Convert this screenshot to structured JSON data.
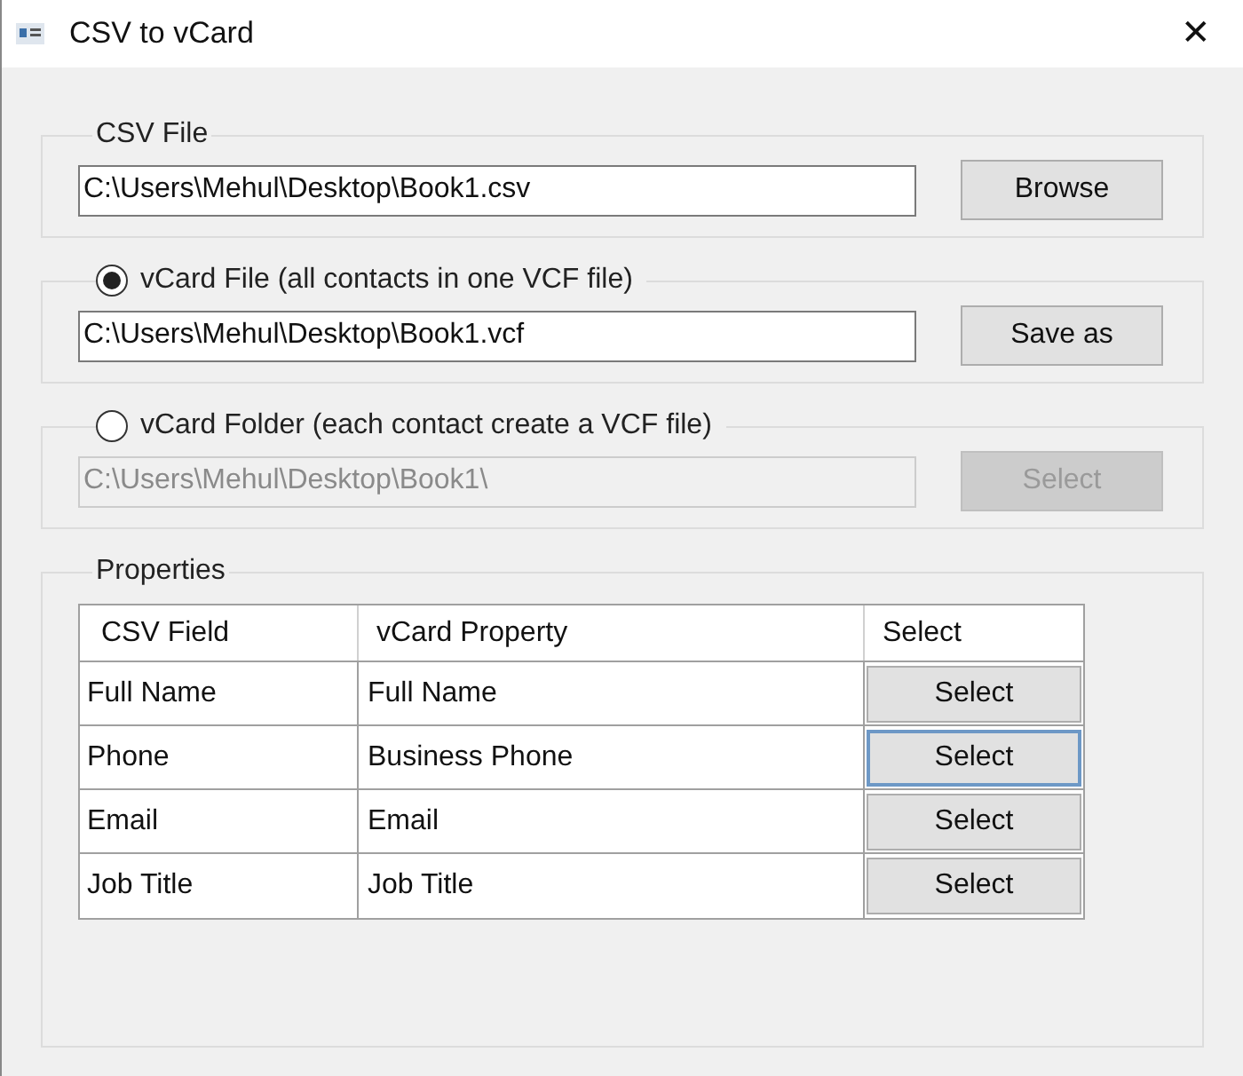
{
  "window": {
    "title": "CSV to vCard",
    "close": "✕"
  },
  "sections": [
    {
      "kind": "plain",
      "label": "CSV File",
      "value": "C:\\Users\\Mehul\\Desktop\\Book1.csv",
      "button": "Browse",
      "disabled": false
    },
    {
      "kind": "radio",
      "label": "vCard File (all contacts in one VCF file)",
      "selected": true,
      "value": "C:\\Users\\Mehul\\Desktop\\Book1.vcf",
      "button": "Save as",
      "disabled": false
    },
    {
      "kind": "radio",
      "label": "vCard Folder (each contact create a VCF file)",
      "selected": false,
      "value": "C:\\Users\\Mehul\\Desktop\\Book1\\",
      "button": "Select",
      "disabled": true
    }
  ],
  "properties": {
    "label": "Properties",
    "columns": [
      "CSV Field",
      "vCard Property",
      "Select"
    ],
    "rows": [
      {
        "csv_field": "Full Name",
        "vcard_property": "Full Name",
        "button": "Select",
        "focused": false
      },
      {
        "csv_field": "Phone",
        "vcard_property": "Business Phone",
        "button": "Select",
        "focused": true
      },
      {
        "csv_field": "Email",
        "vcard_property": "Email",
        "button": "Select",
        "focused": false
      },
      {
        "csv_field": "Job Title",
        "vcard_property": "Job Title",
        "button": "Select",
        "focused": false
      }
    ]
  }
}
